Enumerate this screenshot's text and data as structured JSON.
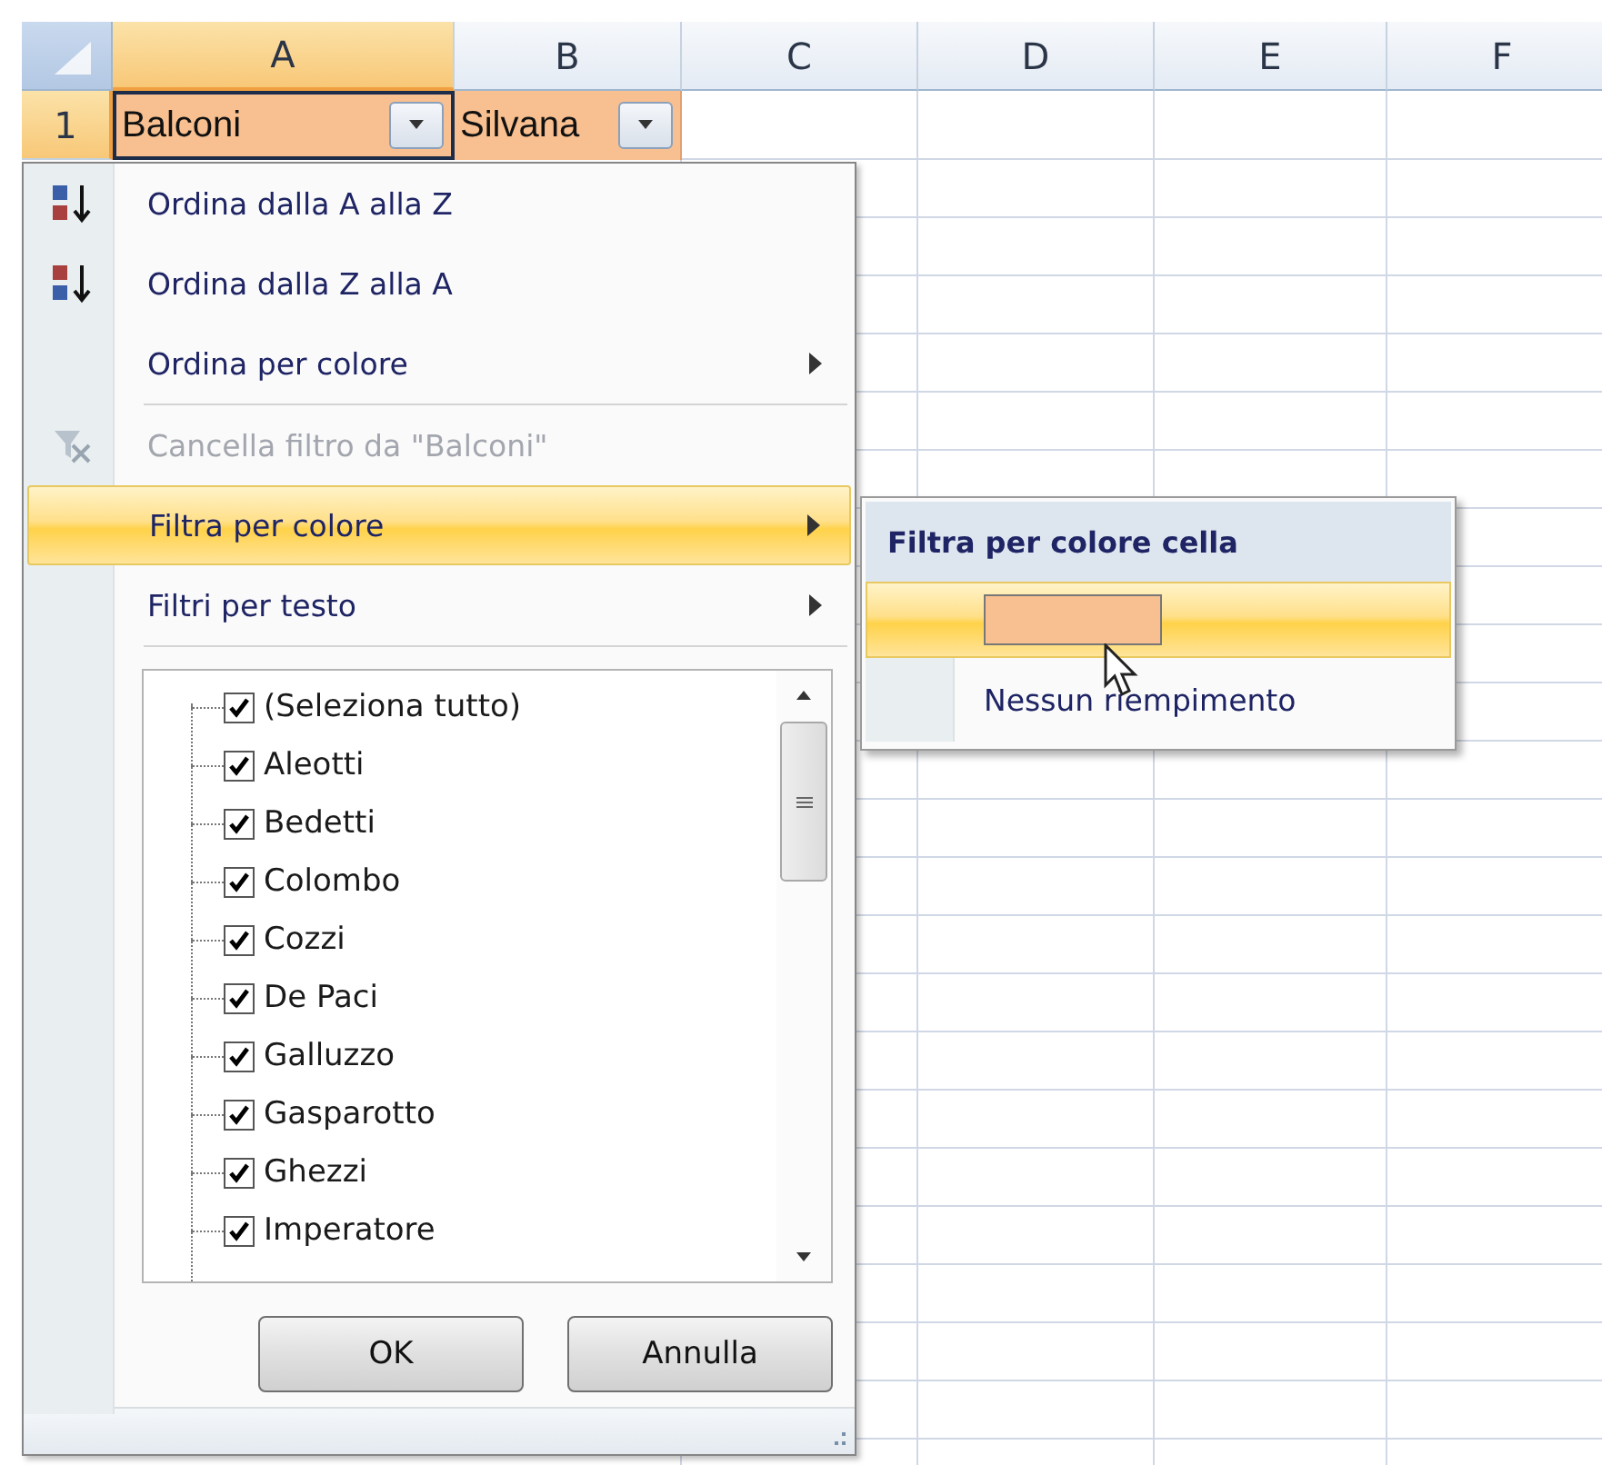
{
  "columns": [
    {
      "label": "A",
      "selected": true
    },
    {
      "label": "B",
      "selected": false
    },
    {
      "label": "C",
      "selected": false
    },
    {
      "label": "D",
      "selected": false
    },
    {
      "label": "E",
      "selected": false
    },
    {
      "label": "F",
      "selected": false
    }
  ],
  "row_header": {
    "label": "1",
    "selected": true
  },
  "header_cells": [
    {
      "value": "Balconi",
      "filter_button": true
    },
    {
      "value": "Silvana",
      "filter_button": true
    }
  ],
  "filter_menu": {
    "items": [
      {
        "kind": "command",
        "label": "Ordina dalla A alla Z",
        "disabled": false,
        "selected": false,
        "submenu": false
      },
      {
        "kind": "command",
        "label": "Ordina dalla Z alla A",
        "disabled": false,
        "selected": false,
        "submenu": false
      },
      {
        "kind": "command",
        "label": "Ordina per colore",
        "disabled": false,
        "selected": false,
        "submenu": true
      },
      {
        "kind": "separator"
      },
      {
        "kind": "command",
        "label": "Cancella filtro da \"Balconi\"",
        "disabled": true,
        "selected": false,
        "submenu": false
      },
      {
        "kind": "command",
        "label": "Filtra per colore",
        "disabled": false,
        "selected": true,
        "submenu": true
      },
      {
        "kind": "command",
        "label": "Filtri per testo",
        "disabled": false,
        "selected": false,
        "submenu": true
      },
      {
        "kind": "separator"
      }
    ],
    "values": [
      {
        "label": "(Seleziona tutto)",
        "checked": true
      },
      {
        "label": "Aleotti",
        "checked": true
      },
      {
        "label": "Bedetti",
        "checked": true
      },
      {
        "label": "Colombo",
        "checked": true
      },
      {
        "label": "Cozzi",
        "checked": true
      },
      {
        "label": "De Paci",
        "checked": true
      },
      {
        "label": "Galluzzo",
        "checked": true
      },
      {
        "label": "Gasparotto",
        "checked": true
      },
      {
        "label": "Ghezzi",
        "checked": true
      },
      {
        "label": "Imperatore",
        "checked": true
      }
    ],
    "buttons": [
      "OK",
      "Annulla"
    ]
  },
  "color_submenu": {
    "heading": "Filtra per colore cella",
    "swatches": [
      {
        "color": "#f8c090",
        "selected": true
      }
    ],
    "no_fill": {
      "label": "Nessun riempimento",
      "selected": false
    }
  }
}
